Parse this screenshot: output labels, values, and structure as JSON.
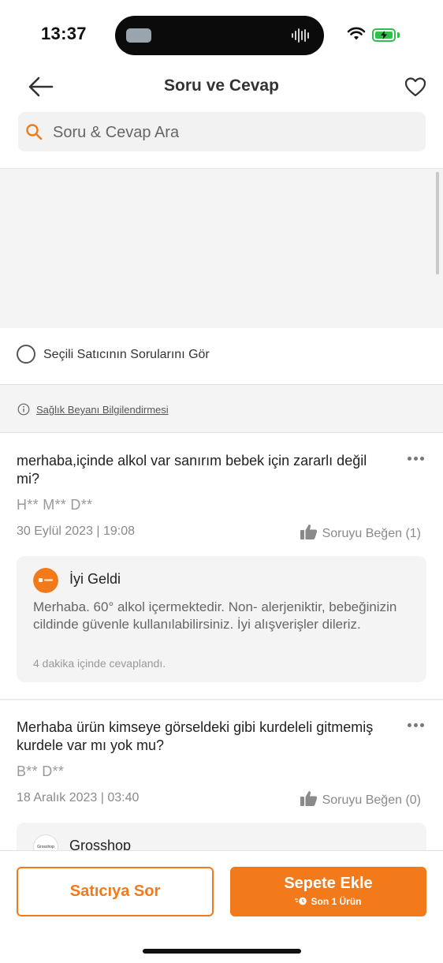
{
  "status_bar": {
    "time": "13:37"
  },
  "header": {
    "title": "Soru ve Cevap"
  },
  "search": {
    "placeholder": "Soru & Cevap Ara"
  },
  "filter": {
    "selected_seller_label": "Seçili Satıcının Sorularını Gör"
  },
  "health_notice": {
    "label": "Sağlık Beyanı Bilgilendirmesi"
  },
  "questions": [
    {
      "text": "merhaba,içinde alkol var sanırım bebek için zararlı değil mi?",
      "author": "H** M** D**",
      "date": "30 Eylül 2023 | 19:08",
      "like_label": "Soruyu Beğen (1)",
      "answer": {
        "seller": "İyi Geldi",
        "logo_text": "iyi geldi",
        "text": "Merhaba. 60° alkol içermektedir. Non- alerjeniktir, bebeğinizin cildinde güvenle kullanılabilirsiniz. İyi alışverişler dileriz.",
        "time": "4 dakika içinde cevaplandı."
      }
    },
    {
      "text": "Merhaba ürün kimseye görseldeki gibi kurdeleli gitmemiş kurdele var mı yok mu?",
      "author": "B** D**",
      "date": "18 Aralık 2023 | 03:40",
      "like_label": "Soruyu Beğen (0)",
      "answer": {
        "seller": "Grosshop",
        "logo_text": "Grosshop"
      }
    }
  ],
  "actions": {
    "ask_seller": "Satıcıya Sor",
    "add_to_cart": "Sepete Ekle",
    "stock_note": "Son 1 Ürün"
  },
  "colors": {
    "accent": "#f27a1a",
    "battery": "#2ec14a"
  }
}
